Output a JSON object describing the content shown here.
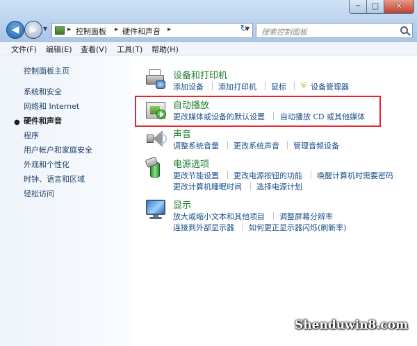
{
  "window": {
    "controls": {
      "minimize": "─",
      "maximize": "□",
      "close": "✕"
    },
    "nav": {
      "back": "◀",
      "forward": "▶"
    },
    "breadcrumbs": [
      "控制面板",
      "硬件和声音"
    ],
    "refresh_icon": "↻",
    "search_placeholder": "搜索控制面板"
  },
  "menubar": [
    "文件(F)",
    "编辑(E)",
    "查看(V)",
    "工具(T)",
    "帮助(H)"
  ],
  "sidebar": {
    "items": [
      {
        "label": "控制面板主页"
      },
      {
        "label": "系统和安全"
      },
      {
        "label": "网络和 Internet"
      },
      {
        "label": "硬件和声音",
        "active": true
      },
      {
        "label": "程序"
      },
      {
        "label": "用户帐户和家庭安全"
      },
      {
        "label": "外观和个性化"
      },
      {
        "label": "时钟、语言和区域"
      },
      {
        "label": "轻松访问"
      }
    ]
  },
  "categories": [
    {
      "title": "设备和打印机",
      "icon": "devices-printers-icon",
      "links": [
        [
          "添加设备",
          "添加打印机",
          "鼠标",
          "设备管理器"
        ]
      ]
    },
    {
      "title": "自动播放",
      "icon": "autoplay-icon",
      "highlighted": true,
      "links": [
        [
          "更改媒体或设备的默认设置",
          "自动播放 CD 或其他媒体"
        ]
      ]
    },
    {
      "title": "声音",
      "icon": "speaker-icon",
      "links": [
        [
          "调整系统音量",
          "更改系统声音",
          "管理音频设备"
        ]
      ]
    },
    {
      "title": "电源选项",
      "icon": "power-battery-icon",
      "links": [
        [
          "更改节能设置",
          "更改电源按钮的功能",
          "唤醒计算机时需要密码"
        ],
        [
          "更改计算机睡眠时间",
          "选择电源计划"
        ]
      ]
    },
    {
      "title": "显示",
      "icon": "display-monitor-icon",
      "links": [
        [
          "放大或缩小文本和其他项目",
          "调整屏幕分辨率"
        ],
        [
          "连接到外部显示器",
          "如何更正显示器闪烁(刷新率)"
        ]
      ]
    }
  ],
  "colors": {
    "category_title": "#1b7b2b",
    "link": "#1b4f8c",
    "highlight_border": "#e0282e"
  },
  "watermark": "Shenduwin8.com"
}
